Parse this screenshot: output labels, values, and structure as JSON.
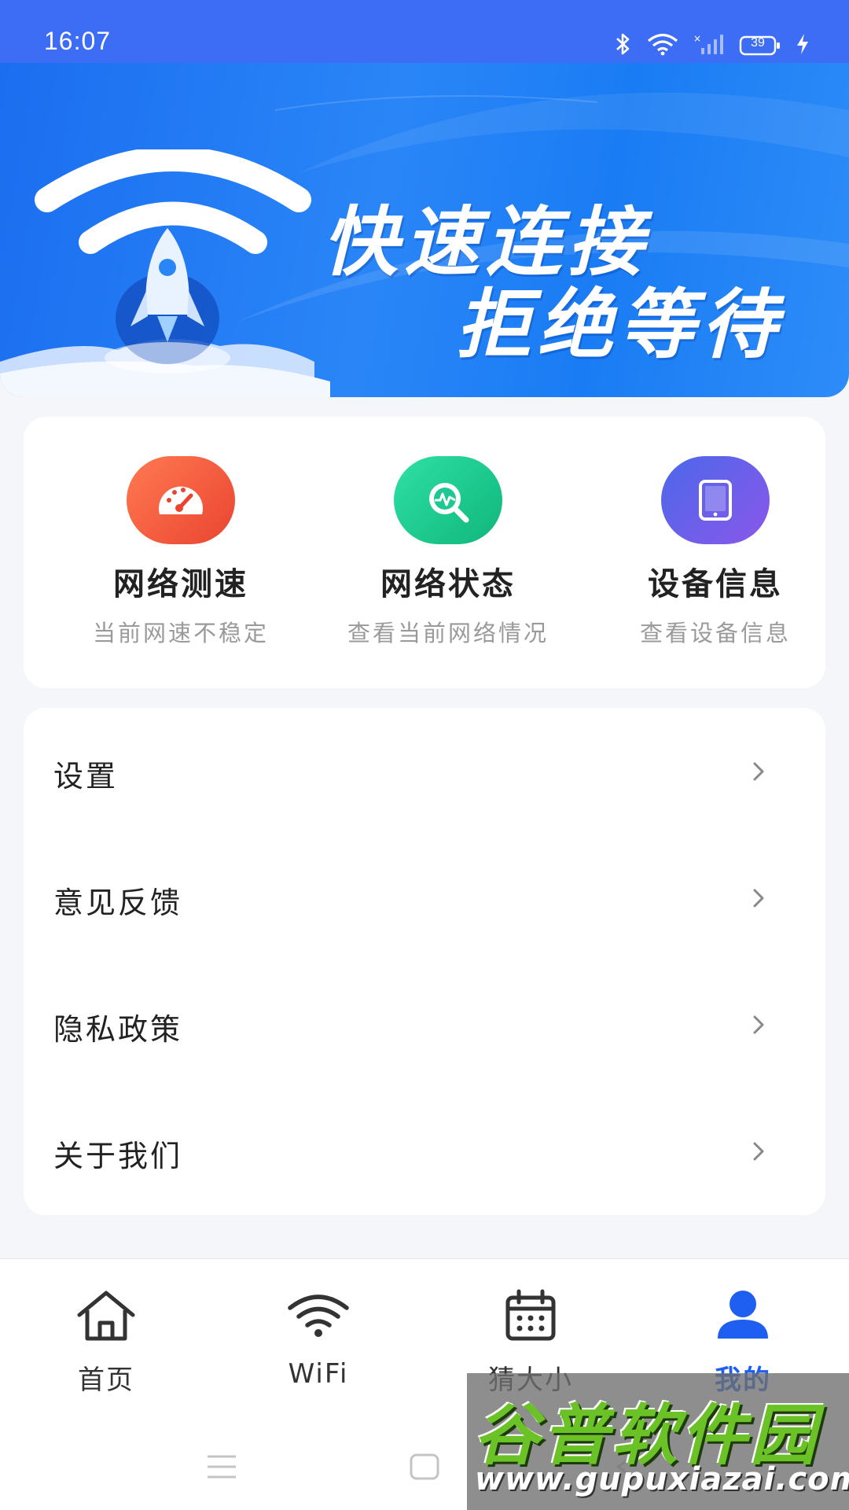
{
  "status_bar": {
    "time": "16:07",
    "battery": "39",
    "icons": [
      "bluetooth-icon",
      "wifi-icon",
      "signal-icon",
      "battery-icon",
      "charging-icon"
    ]
  },
  "banner": {
    "line1": "快速连接",
    "line2": "拒绝等待"
  },
  "features": [
    {
      "title": "网络测速",
      "subtitle": "当前网速不稳定",
      "icon": "speedometer-icon",
      "color": "#f0553a"
    },
    {
      "title": "网络状态",
      "subtitle": "查看当前网络情况",
      "icon": "network-search-icon",
      "color": "#18c48c"
    },
    {
      "title": "设备信息",
      "subtitle": "查看设备信息",
      "icon": "tablet-icon",
      "color": "#6a5cf0"
    }
  ],
  "menu": [
    {
      "label": "设置"
    },
    {
      "label": "意见反馈"
    },
    {
      "label": "隐私政策"
    },
    {
      "label": "关于我们"
    }
  ],
  "tabs": [
    {
      "label": "首页",
      "icon": "home-icon",
      "active": false
    },
    {
      "label": "WiFi",
      "icon": "wifi-icon",
      "active": false
    },
    {
      "label": "猜大小",
      "icon": "calendar-icon",
      "active": false
    },
    {
      "label": "我的",
      "icon": "user-icon",
      "active": true
    }
  ],
  "watermark": {
    "title": "谷普软件园",
    "url": "www.gupuxiazai.com"
  },
  "colors": {
    "status_bar": "#3d6cf5",
    "accent": "#1e5ef0",
    "background": "#f4f6fa"
  }
}
